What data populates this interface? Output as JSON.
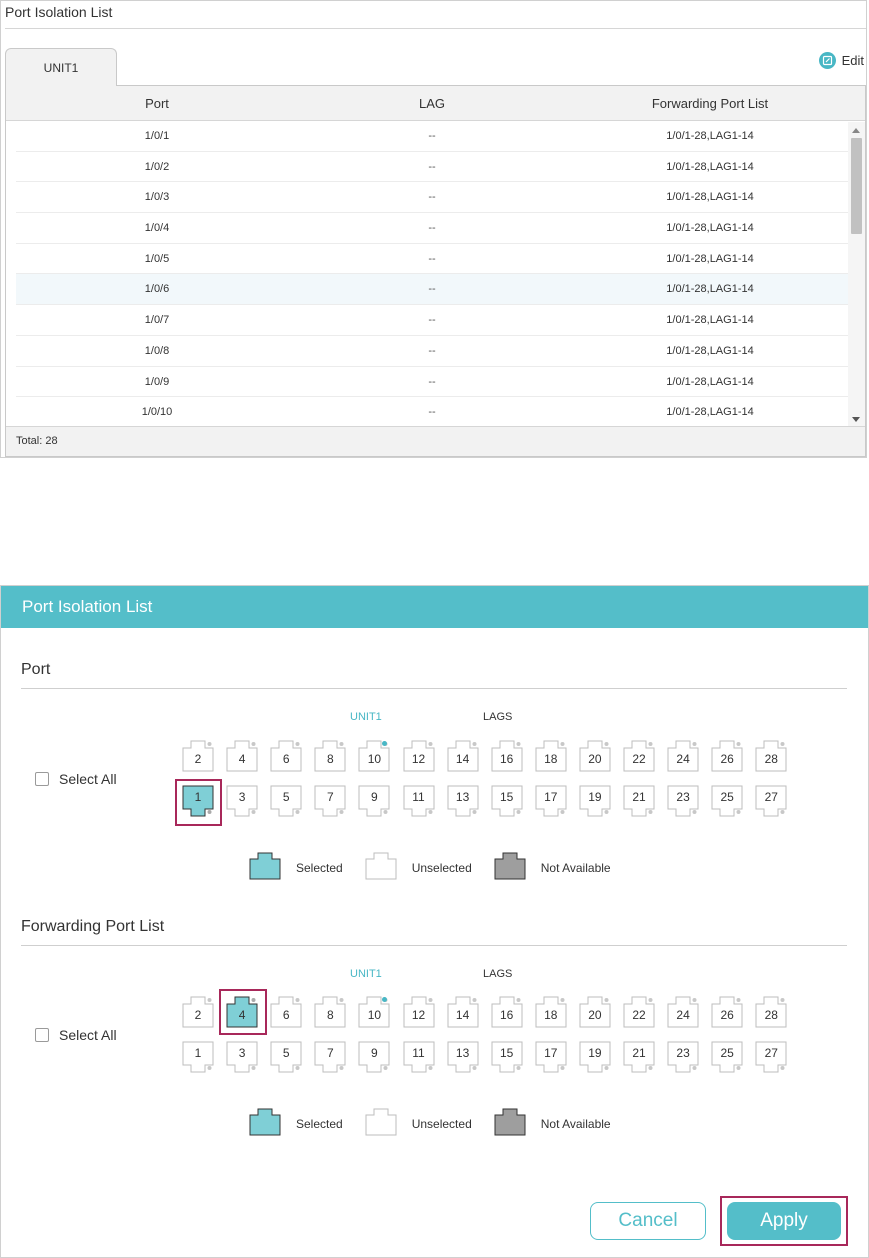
{
  "top": {
    "title": "Port Isolation List",
    "tab": "UNIT1",
    "edit_label": "Edit",
    "columns": [
      "Port",
      "LAG",
      "Forwarding Port List"
    ],
    "rows": [
      {
        "port": "1/0/1",
        "lag": "--",
        "fwd": "1/0/1-28,LAG1-14"
      },
      {
        "port": "1/0/2",
        "lag": "--",
        "fwd": "1/0/1-28,LAG1-14"
      },
      {
        "port": "1/0/3",
        "lag": "--",
        "fwd": "1/0/1-28,LAG1-14"
      },
      {
        "port": "1/0/4",
        "lag": "--",
        "fwd": "1/0/1-28,LAG1-14"
      },
      {
        "port": "1/0/5",
        "lag": "--",
        "fwd": "1/0/1-28,LAG1-14"
      },
      {
        "port": "1/0/6",
        "lag": "--",
        "fwd": "1/0/1-28,LAG1-14"
      },
      {
        "port": "1/0/7",
        "lag": "--",
        "fwd": "1/0/1-28,LAG1-14"
      },
      {
        "port": "1/0/8",
        "lag": "--",
        "fwd": "1/0/1-28,LAG1-14"
      },
      {
        "port": "1/0/9",
        "lag": "--",
        "fwd": "1/0/1-28,LAG1-14"
      },
      {
        "port": "1/0/10",
        "lag": "--",
        "fwd": "1/0/1-28,LAG1-14"
      }
    ],
    "total": "Total: 28"
  },
  "dialog": {
    "title": "Port Isolation List",
    "port_section": {
      "title": "Port",
      "unit_label": "UNIT1",
      "lags_label": "LAGS",
      "select_all": "Select All",
      "top_row": [
        "2",
        "4",
        "6",
        "8",
        "10",
        "12",
        "14",
        "16",
        "18",
        "20",
        "22",
        "24",
        "26",
        "28"
      ],
      "bottom_row": [
        "1",
        "3",
        "5",
        "7",
        "9",
        "11",
        "13",
        "15",
        "17",
        "19",
        "21",
        "23",
        "25",
        "27"
      ],
      "selected": [
        "1"
      ]
    },
    "fwd_section": {
      "title": "Forwarding Port List",
      "unit_label": "UNIT1",
      "lags_label": "LAGS",
      "select_all": "Select All",
      "top_row": [
        "2",
        "4",
        "6",
        "8",
        "10",
        "12",
        "14",
        "16",
        "18",
        "20",
        "22",
        "24",
        "26",
        "28"
      ],
      "bottom_row": [
        "1",
        "3",
        "5",
        "7",
        "9",
        "11",
        "13",
        "15",
        "17",
        "19",
        "21",
        "23",
        "25",
        "27"
      ],
      "selected": [
        "4"
      ]
    },
    "legend": {
      "selected": "Selected",
      "unselected": "Unselected",
      "not_available": "Not Available"
    },
    "cancel_label": "Cancel",
    "apply_label": "Apply"
  },
  "colors": {
    "accent": "#54bec9",
    "selected_port": "#7fcfd6",
    "not_available": "#9e9e9e",
    "highlight": "#a8285a"
  }
}
